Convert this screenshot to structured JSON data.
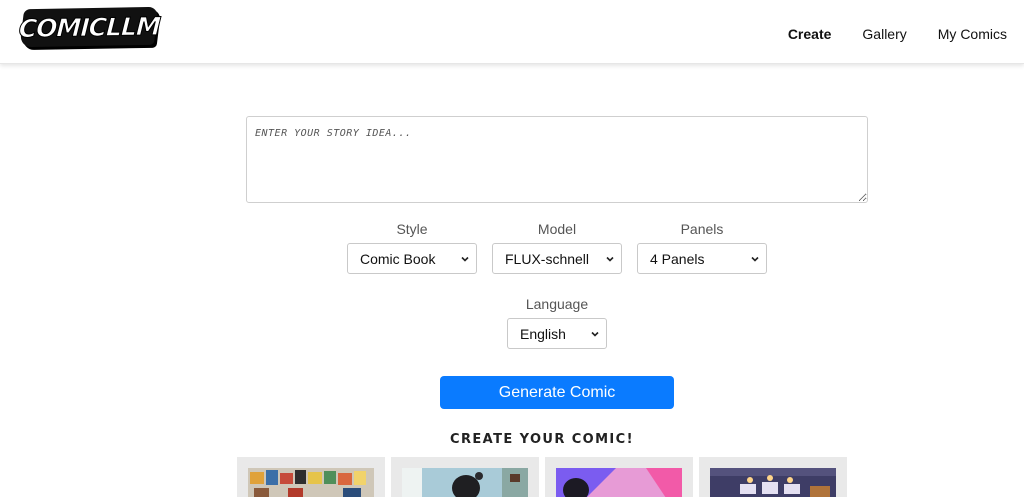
{
  "nav": {
    "logo_text": "COMICLLM",
    "links": [
      {
        "label": "Create",
        "active": true
      },
      {
        "label": "Gallery",
        "active": false
      },
      {
        "label": "My Comics",
        "active": false
      }
    ]
  },
  "form": {
    "story_placeholder": "ENTER YOUR STORY IDEA...",
    "style": {
      "label": "Style",
      "value": "Comic Book"
    },
    "model": {
      "label": "Model",
      "value": "FLUX-schnell"
    },
    "panels": {
      "label": "Panels",
      "value": "4 Panels"
    },
    "language": {
      "label": "Language",
      "value": "English"
    },
    "generate_label": "Generate Comic"
  },
  "gallery": {
    "heading": "CREATE YOUR COMIC!",
    "cards": [
      {
        "icon": "comic-wall-thumbnail"
      },
      {
        "icon": "person-room-thumbnail"
      },
      {
        "icon": "person-pink-thumbnail"
      },
      {
        "icon": "room-lamps-thumbnail"
      }
    ]
  },
  "colors": {
    "accent": "#0a7bff",
    "card_bg": "#e9e9e9"
  }
}
